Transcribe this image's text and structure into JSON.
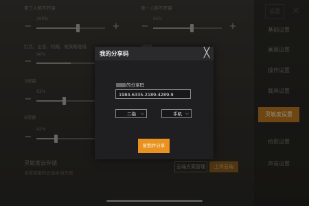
{
  "background": {
    "sliders": [
      {
        "label": "第三人称不开镜",
        "value": "100%"
      },
      {
        "label": "第一人称不开镜",
        "value": "95%"
      },
      {
        "label": "红点、全息、机瞄、枪族瞄准镜",
        "value": "90%"
      },
      {
        "label": "2倍镜",
        "value": "Mini14"
      },
      {
        "label": "3倍镜",
        "value": "62%"
      },
      {
        "label": "6倍镜",
        "value": "42%"
      }
    ],
    "tabs": [
      "基础设置",
      "画面设置",
      "操作设置",
      "载具设置",
      "灵敏度设置",
      "拾取设置",
      "声音设置"
    ],
    "top_settings": "设置",
    "bottom": {
      "title": "灵敏度云存储",
      "subtitle": "当前使用的云端本地方案",
      "buttons": [
        "云端方案管理",
        "上传云端"
      ]
    }
  },
  "modal": {
    "title": "我的分享码",
    "close_symbol": "╳",
    "code_label_suffix": "的分享码",
    "share_code": "1984-6335-2189-4289-9",
    "select_left": "二指",
    "select_right": "手机",
    "copy_button": "复制并分享"
  },
  "icons": {
    "chevron": "⌵",
    "minus": "−",
    "plus": "+"
  },
  "colors": {
    "accent": "#e9921f",
    "modal_bg": "#1f1f21"
  }
}
